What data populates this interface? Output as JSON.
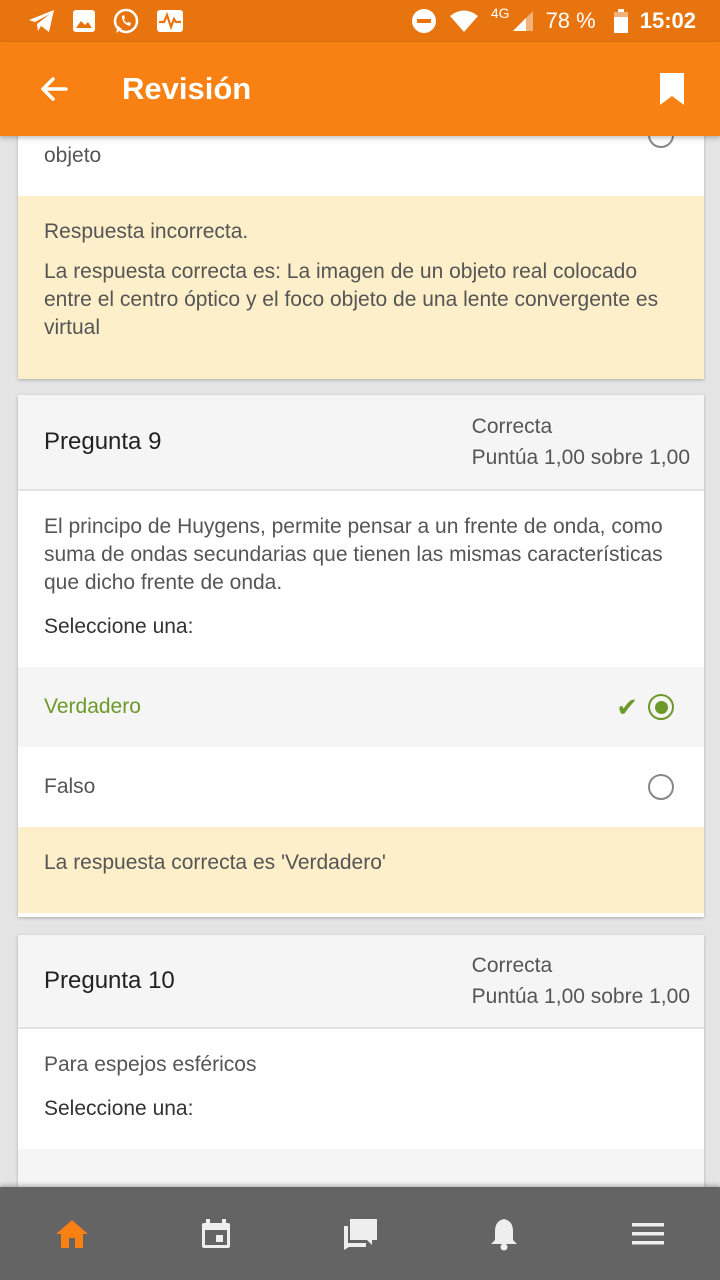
{
  "status_bar": {
    "network": "4G",
    "battery": "78 %",
    "time": "15:02"
  },
  "app_bar": {
    "title": "Revisión"
  },
  "prev_question": {
    "last_option_text": "objeto",
    "feedback_line1": "Respuesta incorrecta.",
    "feedback_line2": "La respuesta correcta es: La imagen de un objeto real colocado entre el centro óptico y el foco objeto de una lente convergente es virtual"
  },
  "question9": {
    "title": "Pregunta 9",
    "status": "Correcta",
    "grade": "Puntúa 1,00 sobre 1,00",
    "text": "El principo de Huygens, permite pensar a un frente de onda, como suma de ondas secundarias que tienen las mismas características que dicho frente de onda.",
    "prompt": "Seleccione una:",
    "options": [
      {
        "label": "Verdadero"
      },
      {
        "label": "Falso"
      }
    ],
    "feedback": "La respuesta correcta es 'Verdadero'"
  },
  "question10": {
    "title": "Pregunta 10",
    "status": "Correcta",
    "grade": "Puntúa 1,00 sobre 1,00",
    "text": "Para espejos esféricos",
    "prompt": "Seleccione una:"
  },
  "bottom_nav": [
    {
      "icon": "home-icon",
      "active": true
    },
    {
      "icon": "calendar-icon",
      "active": false
    },
    {
      "icon": "messages-icon",
      "active": false
    },
    {
      "icon": "bell-icon",
      "active": false
    },
    {
      "icon": "menu-icon",
      "active": false
    }
  ],
  "colors": {
    "status_bar": "#e7740e",
    "app_bar": "#f98012",
    "correct_green": "#6b9a2a",
    "feedback_bg": "#fdefc9",
    "bottom_nav": "#646464",
    "nav_active": "#f98012"
  }
}
